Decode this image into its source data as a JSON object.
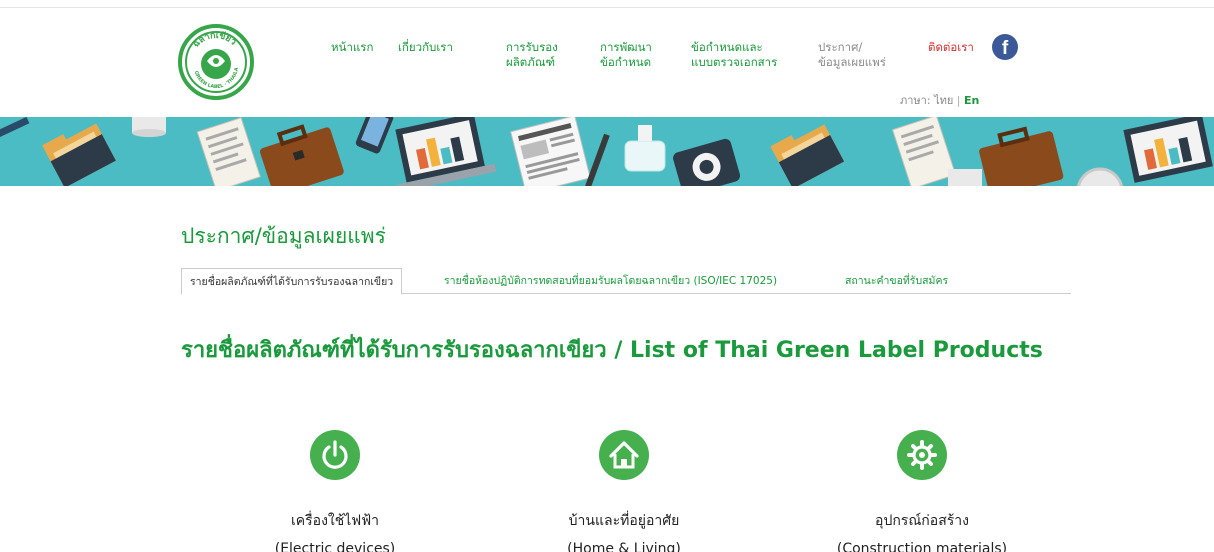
{
  "logo": {
    "text": "ฉลากเขียว",
    "subtext": "GREEN LABEL · THAILAND",
    "ring_color": "#37a64a"
  },
  "nav": {
    "items": [
      {
        "label": "หน้าแรก"
      },
      {
        "label": "เกี่ยวกับเรา"
      },
      {
        "line1": "การรับรอง",
        "line2": "ผลิตภัณฑ์"
      },
      {
        "line1": "การพัฒนา",
        "line2": "ข้อกำหนด"
      },
      {
        "line1": "ข้อกำหนดและ",
        "line2": "แบบตรวจเอกสาร"
      },
      {
        "line1": "ประกาศ/",
        "line2": "ข้อมูลเผยแพร่"
      },
      {
        "label": "ติดต่อเรา"
      }
    ],
    "facebook_icon": "facebook-icon"
  },
  "language": {
    "label": "ภาษา:",
    "thai": "ไทย",
    "separator": "|",
    "english": "En"
  },
  "page": {
    "title": "ประกาศ/ข้อมูลเผยแพร่"
  },
  "tabs": [
    {
      "label": "รายชื่อผลิตภัณฑ์ที่ได้รับการรับรองฉลากเขียว",
      "active": true
    },
    {
      "label": "รายชื่อห้องปฏิบัติการทดสอบที่ยอมรับผลโดยฉลากเขียว (ISO/IEC 17025)",
      "active": false
    },
    {
      "label": "สถานะคำขอที่รับสมัคร",
      "active": false
    }
  ],
  "list": {
    "title": "รายชื่อผลิตภัณฑ์ที่ได้รับการรับรองฉลากเขียว / List of Thai Green Label Products"
  },
  "categories": [
    {
      "icon": "power-icon",
      "name_th": "เครื่องใช้ไฟฟ้า",
      "name_en": "(Electric devices)"
    },
    {
      "icon": "home-icon",
      "name_th": "บ้านและที่อยู่อาศัย",
      "name_en": "(Home & Living)"
    },
    {
      "icon": "gear-icon",
      "name_th": "อุปกรณ์ก่อสร้าง",
      "name_en": "(Construction materials)"
    }
  ],
  "colors": {
    "brand_green": "#1a9a3c",
    "icon_green": "#46b04f",
    "banner_teal": "#4bbcc3",
    "facebook_blue": "#3b5998"
  }
}
